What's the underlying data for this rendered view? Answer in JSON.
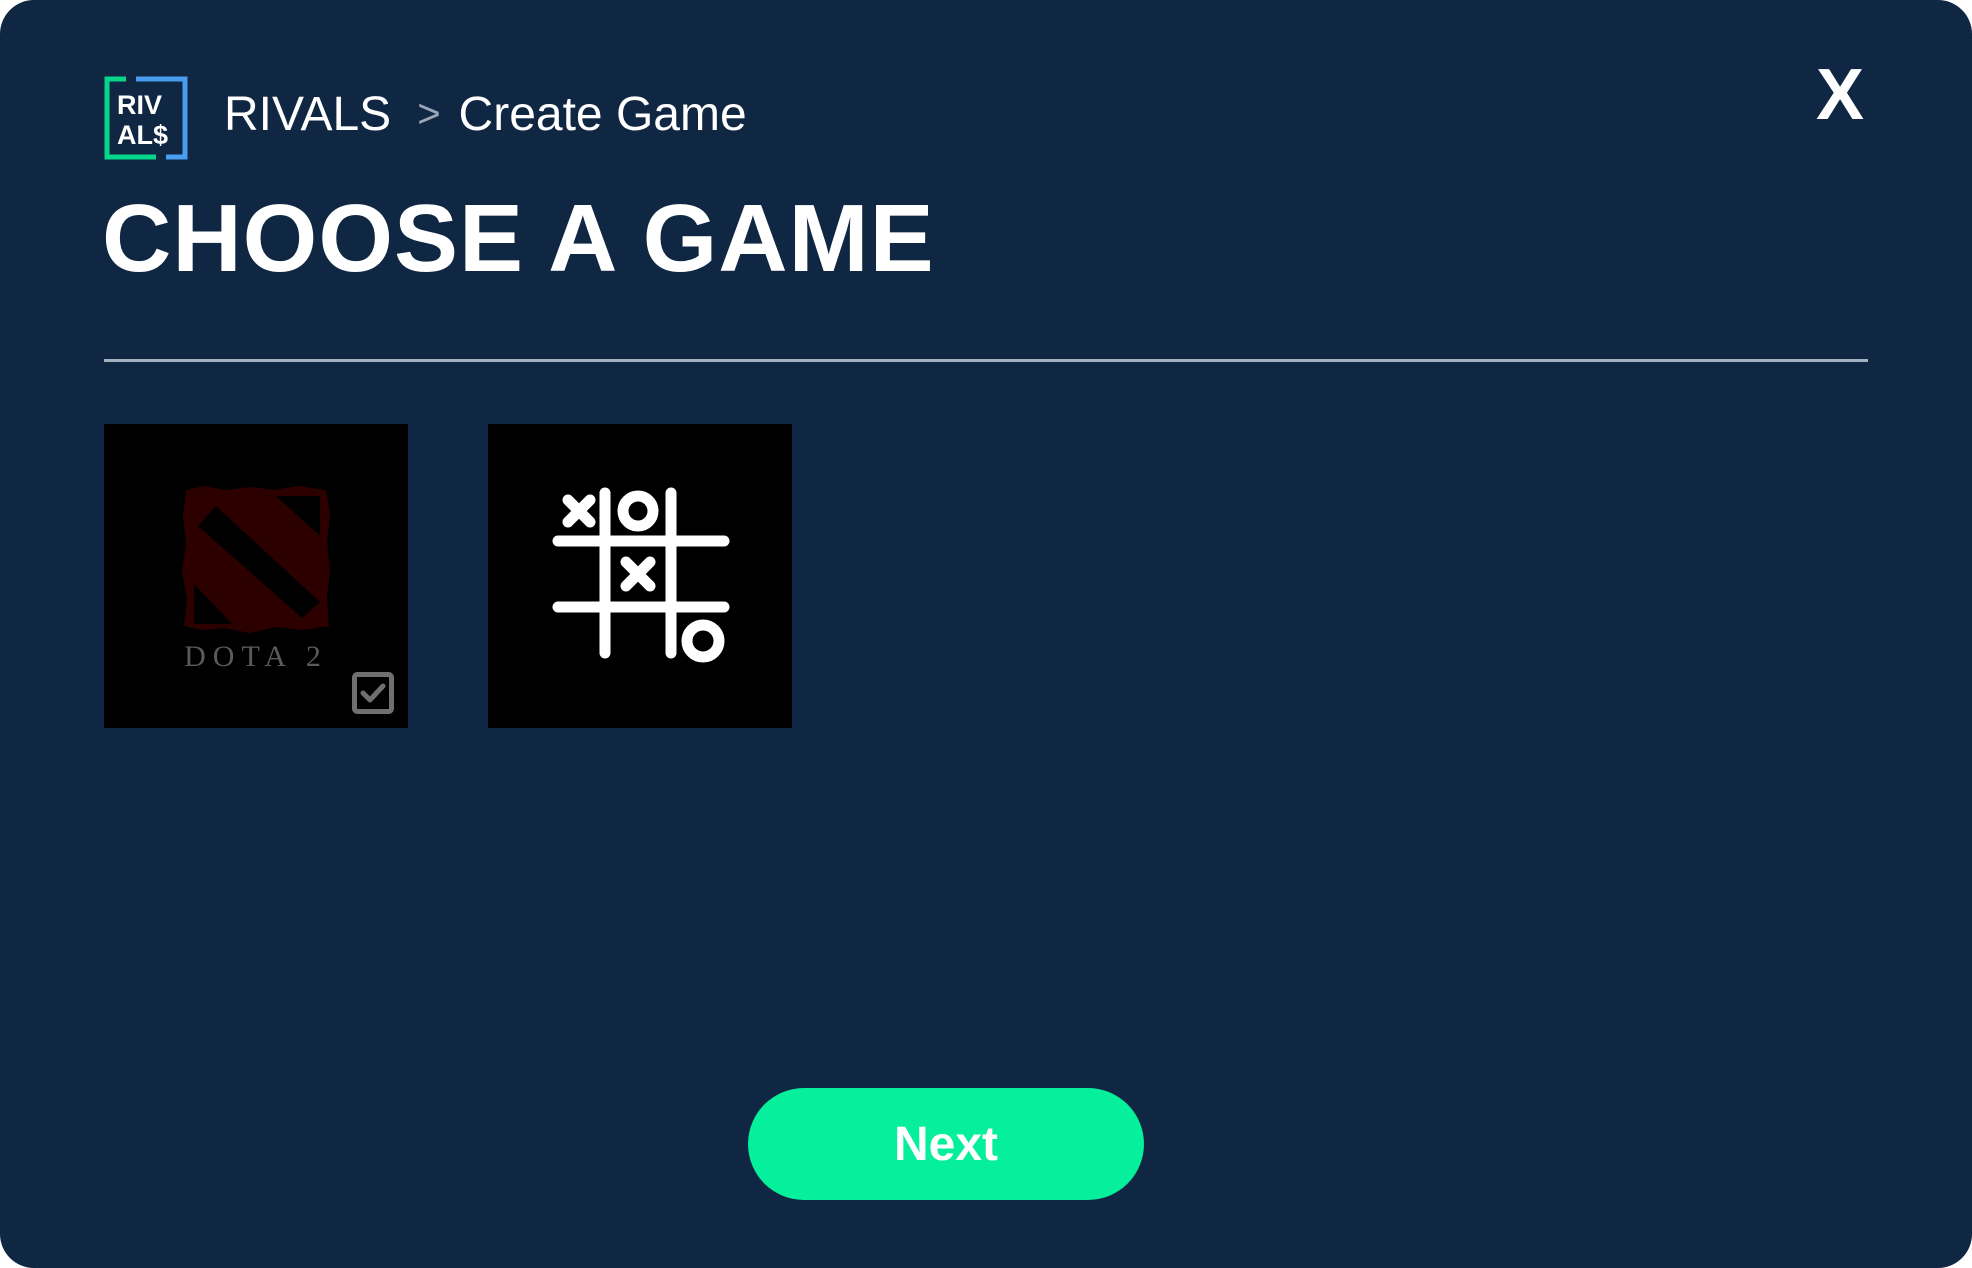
{
  "logo": {
    "line1": "RIV",
    "line2": "AL$",
    "colors": {
      "left_bracket": "#06d68a",
      "right_bracket": "#4a9ef0"
    }
  },
  "breadcrumb": {
    "root": "RIVALS",
    "separator": ">",
    "current": "Create Game"
  },
  "close_button": {
    "label": "X"
  },
  "page_title": "CHOOSE A GAME",
  "games": [
    {
      "id": "dota2",
      "label": "DOTA 2",
      "icon": "dota2-logo-icon",
      "selected": true
    },
    {
      "id": "tictactoe",
      "label": "",
      "icon": "tic-tac-toe-icon",
      "selected": false
    }
  ],
  "next_button": {
    "label": "Next"
  },
  "colors": {
    "background": "#0f2742",
    "accent": "#06ef9c",
    "divider": "#a3b0bf",
    "card": "#000000"
  }
}
